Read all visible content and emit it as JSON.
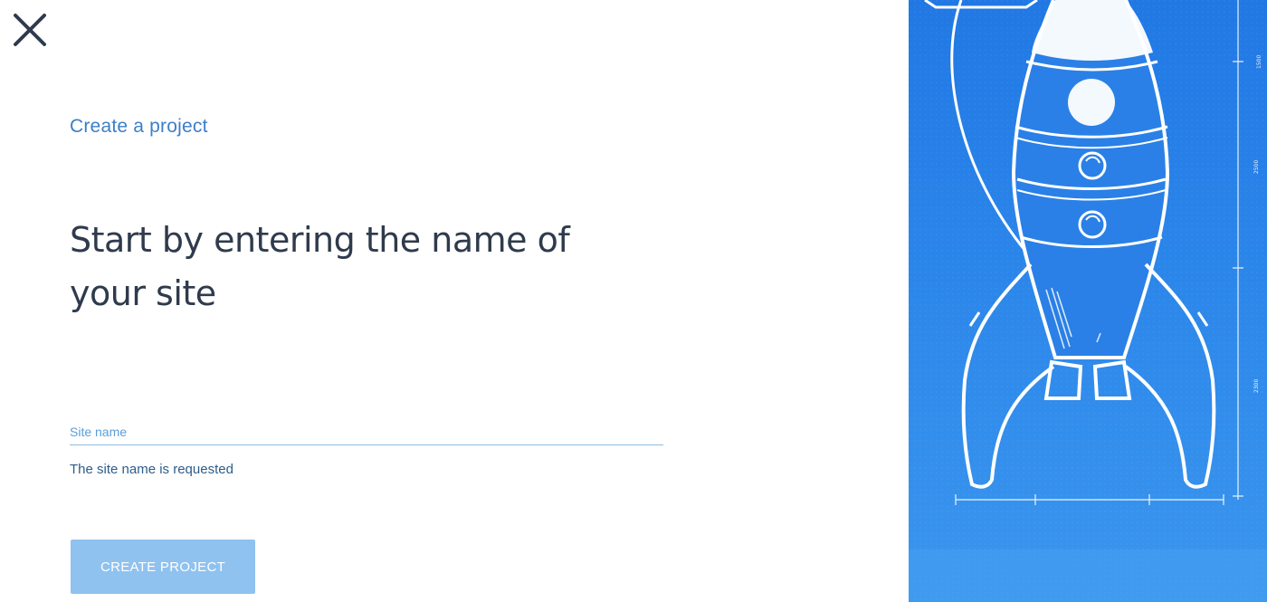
{
  "header": {
    "close_icon": "close-icon"
  },
  "form": {
    "eyebrow": "Create a project",
    "heading": "Start by entering the name of your site",
    "site_name_placeholder": "Site name",
    "site_name_value": "",
    "helper_text": "The site name is requested",
    "submit_label": "CREATE PROJECT"
  },
  "illustration": {
    "icon": "rocket-blueprint-illustration",
    "dimension_labels": [
      "1500",
      "2500",
      "2300"
    ]
  },
  "colors": {
    "accent": "#3d7fc8",
    "button": "#8fc2ef",
    "panel": "#2b86ea",
    "heading": "#2f3b4c"
  }
}
